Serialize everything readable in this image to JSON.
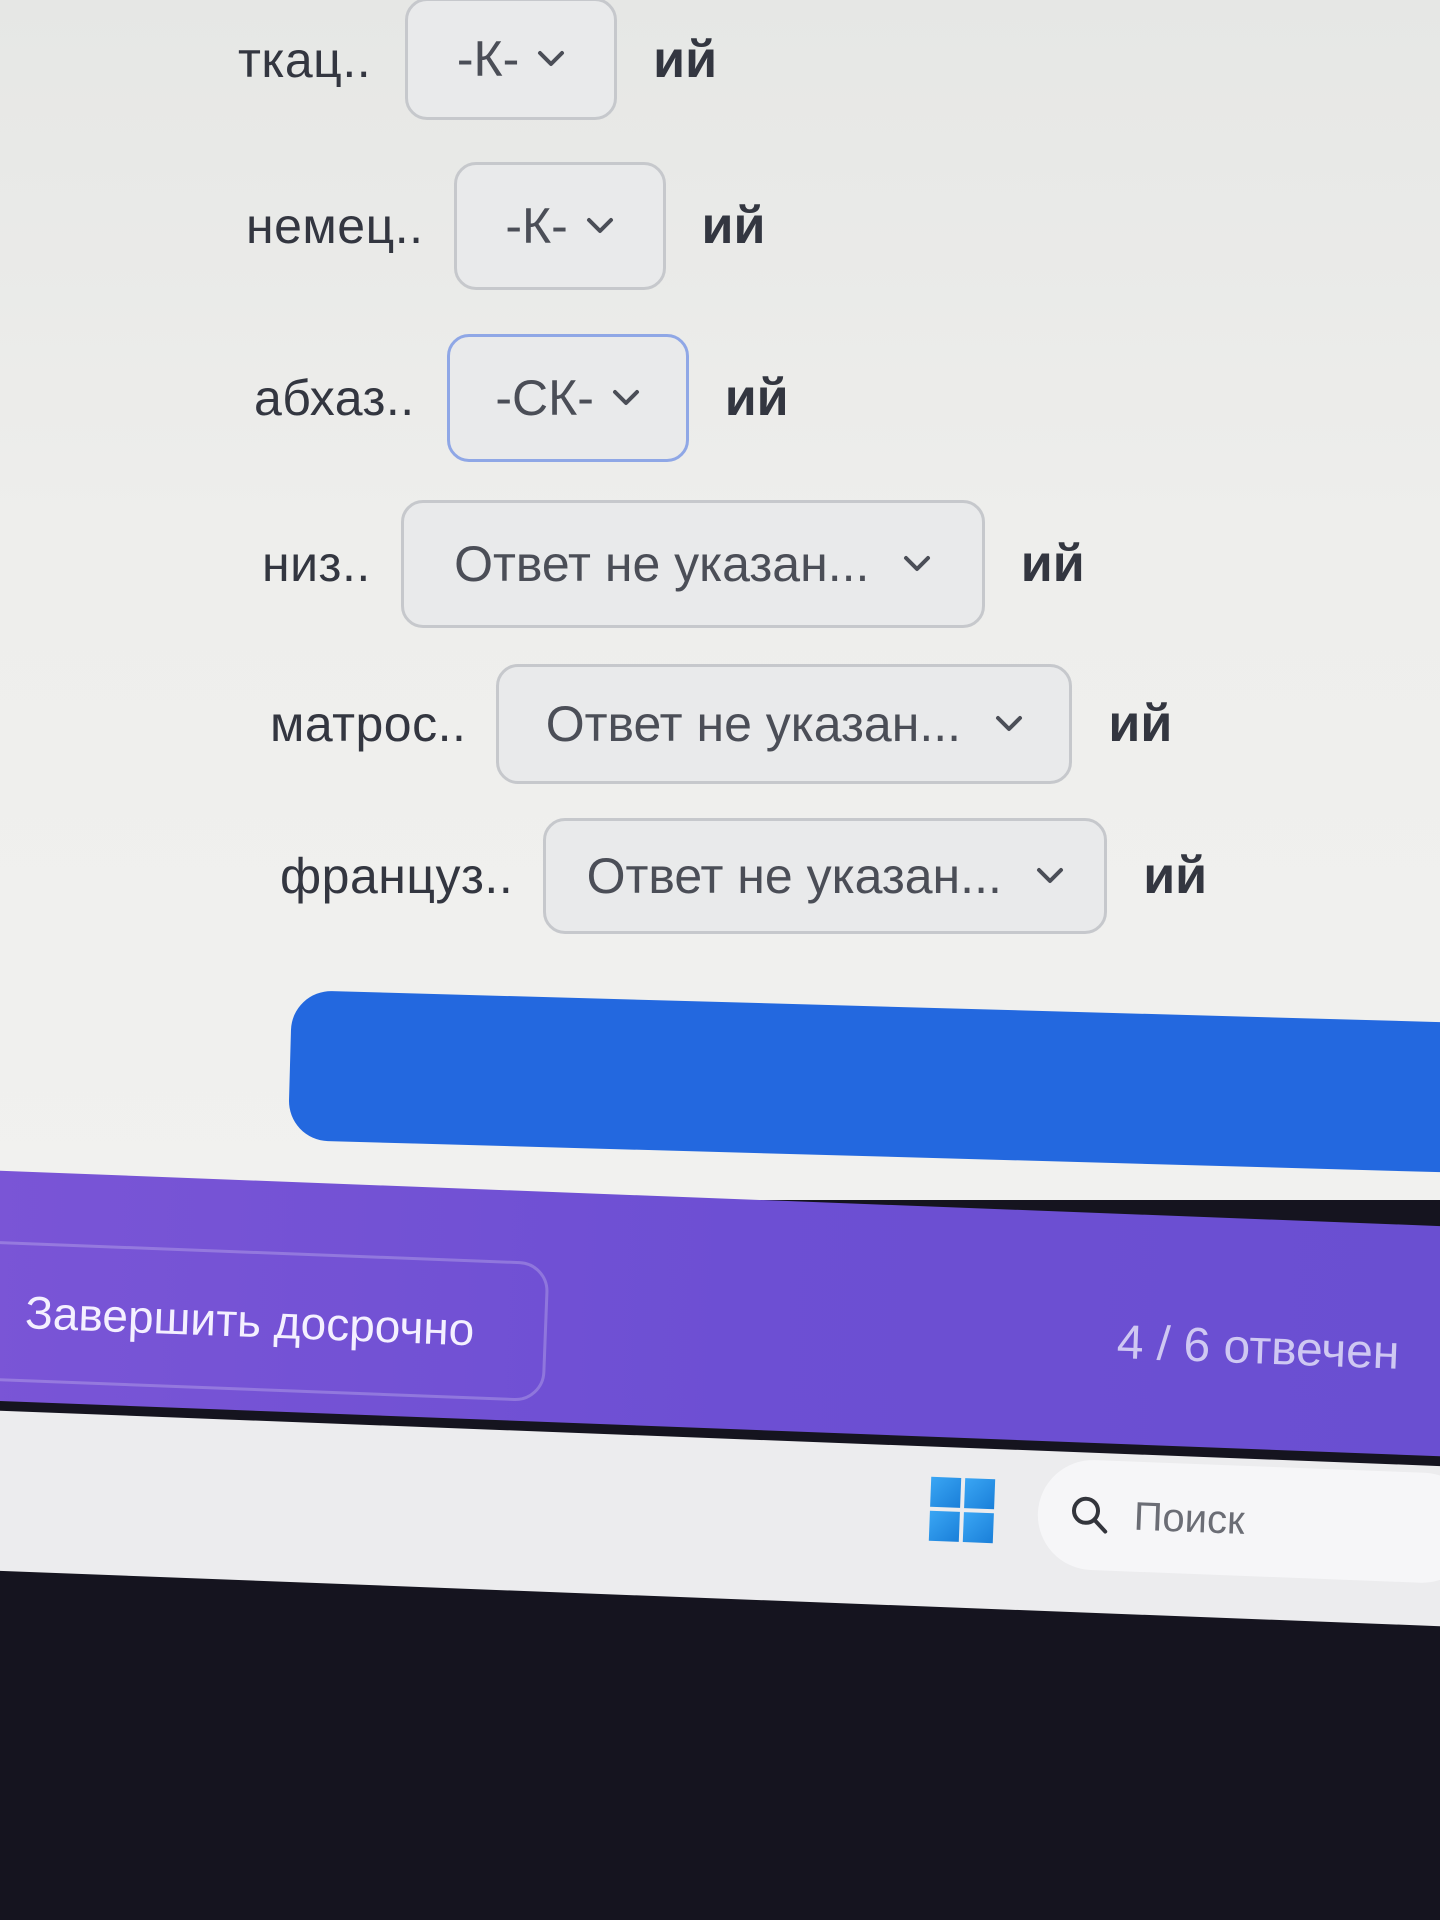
{
  "rows": [
    {
      "prefix": "ткац..",
      "value": "-К-",
      "suffix": "ий",
      "focused": false
    },
    {
      "prefix": "немец..",
      "value": "-К-",
      "suffix": "ий",
      "focused": false
    },
    {
      "prefix": "абхаз..",
      "value": "-СК-",
      "suffix": "ий",
      "focused": true
    },
    {
      "prefix": "низ..",
      "value": "Ответ не указан...",
      "suffix": "ий",
      "focused": false
    },
    {
      "prefix": "матрос..",
      "value": "Ответ не указан...",
      "suffix": "ий",
      "focused": false
    },
    {
      "prefix": "француз..",
      "value": "Ответ не указан...",
      "suffix": "ий",
      "focused": false
    }
  ],
  "footer": {
    "finish_label": "Завершить досрочно",
    "progress_text": "4 / 6 отвечен"
  },
  "taskbar": {
    "search_placeholder": "Поиск"
  },
  "colors": {
    "submit_button": "#2368df",
    "footer_bar": "#7a55d6",
    "focus_border": "#8fa7e6"
  },
  "icons": {
    "dropdown": "chevron-down-icon",
    "start": "windows-logo-icon",
    "search": "search-icon"
  }
}
